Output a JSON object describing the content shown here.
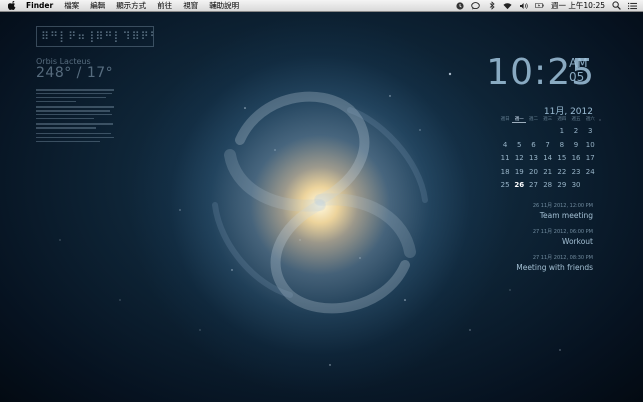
{
  "menubar": {
    "items": [
      "Finder",
      "檔案",
      "編輯",
      "顯示方式",
      "前往",
      "視窗",
      "輔助說明"
    ],
    "clock": "週一 上午10:25",
    "icons": [
      "apple-icon",
      "timemachine-icon",
      "chat-icon",
      "bluetooth-icon",
      "wifi-icon",
      "volume-icon",
      "battery-icon",
      "spotlight-icon",
      "list-icon"
    ]
  },
  "left_widget": {
    "glyphs": "⠿⠛⡇⠟⠶⢸⠿⠛⡇⠹⠿⠟⠛⡇",
    "name": "Orbis Lacteus",
    "coords": "248° / 17°"
  },
  "clock": {
    "time": "10:25",
    "ampm": "AM",
    "seconds": "05"
  },
  "calendar": {
    "month_title": "11月, 2012",
    "weekdays": [
      "週日",
      "週一",
      "週二",
      "週三",
      "週四",
      "週五",
      "週六"
    ],
    "selected_weekday_index": 1,
    "weeks": [
      [
        "",
        "",
        "",
        "",
        "1",
        "2",
        "3"
      ],
      [
        "4",
        "5",
        "6",
        "7",
        "8",
        "9",
        "10"
      ],
      [
        "11",
        "12",
        "13",
        "14",
        "15",
        "16",
        "17"
      ],
      [
        "18",
        "19",
        "20",
        "21",
        "22",
        "23",
        "24"
      ],
      [
        "25",
        "26",
        "27",
        "28",
        "29",
        "30",
        ""
      ]
    ],
    "today": "26"
  },
  "events": [
    {
      "datetime": "26 11月 2012, 12:00 PM",
      "title": "Team meeting"
    },
    {
      "datetime": "27 11月 2012, 06:00 PM",
      "title": "Workout"
    },
    {
      "datetime": "27 11月 2012, 08:30 PM",
      "title": "Meeting with friends"
    }
  ]
}
